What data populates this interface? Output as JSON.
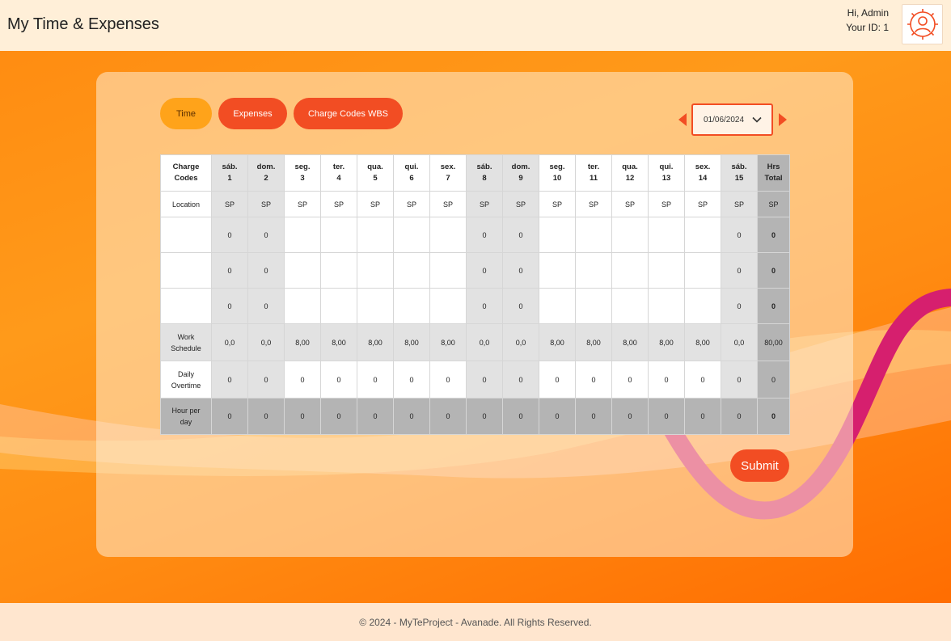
{
  "header": {
    "title": "My Time & Expenses",
    "greeting": "Hi, Admin",
    "user_id": "Your ID: 1"
  },
  "tabs": {
    "time": "Time",
    "expenses": "Expenses",
    "wbs": "Charge Codes WBS"
  },
  "date_picker": {
    "value": "01/06/2024"
  },
  "table": {
    "charge_codes_header": [
      "Charge",
      "Codes"
    ],
    "total_header": [
      "Hrs",
      "Total"
    ],
    "days": [
      {
        "dow": "sáb.",
        "day": "1",
        "weekend": true
      },
      {
        "dow": "dom.",
        "day": "2",
        "weekend": true
      },
      {
        "dow": "seg.",
        "day": "3",
        "weekend": false
      },
      {
        "dow": "ter.",
        "day": "4",
        "weekend": false
      },
      {
        "dow": "qua.",
        "day": "5",
        "weekend": false
      },
      {
        "dow": "qui.",
        "day": "6",
        "weekend": false
      },
      {
        "dow": "sex.",
        "day": "7",
        "weekend": false
      },
      {
        "dow": "sáb.",
        "day": "8",
        "weekend": true
      },
      {
        "dow": "dom.",
        "day": "9",
        "weekend": true
      },
      {
        "dow": "seg.",
        "day": "10",
        "weekend": false
      },
      {
        "dow": "ter.",
        "day": "11",
        "weekend": false
      },
      {
        "dow": "qua.",
        "day": "12",
        "weekend": false
      },
      {
        "dow": "qui.",
        "day": "13",
        "weekend": false
      },
      {
        "dow": "sex.",
        "day": "14",
        "weekend": false
      },
      {
        "dow": "sáb.",
        "day": "15",
        "weekend": true
      }
    ],
    "location_label": "Location",
    "location_values": [
      "SP",
      "SP",
      "SP",
      "SP",
      "SP",
      "SP",
      "SP",
      "SP",
      "SP",
      "SP",
      "SP",
      "SP",
      "SP",
      "SP",
      "SP"
    ],
    "location_total": "SP",
    "entry_rows": [
      {
        "values": [
          "0",
          "0",
          "",
          "",
          "",
          "",
          "",
          "0",
          "0",
          "",
          "",
          "",
          "",
          "",
          "0"
        ],
        "total": "0"
      },
      {
        "values": [
          "0",
          "0",
          "",
          "",
          "",
          "",
          "",
          "0",
          "0",
          "",
          "",
          "",
          "",
          "",
          "0"
        ],
        "total": "0"
      },
      {
        "values": [
          "0",
          "0",
          "",
          "",
          "",
          "",
          "",
          "0",
          "0",
          "",
          "",
          "",
          "",
          "",
          "0"
        ],
        "total": "0"
      }
    ],
    "work_schedule_label": [
      "Work",
      "Schedule"
    ],
    "work_schedule_values": [
      "0,0",
      "0,0",
      "8,00",
      "8,00",
      "8,00",
      "8,00",
      "8,00",
      "0,0",
      "0,0",
      "8,00",
      "8,00",
      "8,00",
      "8,00",
      "8,00",
      "0,0"
    ],
    "work_schedule_total": "80,00",
    "overtime_label": [
      "Daily",
      "Overtime"
    ],
    "overtime_values": [
      "0",
      "0",
      "0",
      "0",
      "0",
      "0",
      "0",
      "0",
      "0",
      "0",
      "0",
      "0",
      "0",
      "0",
      "0"
    ],
    "overtime_total": "0",
    "hour_per_day_label": [
      "Hour per",
      "day"
    ],
    "hour_per_day_values": [
      "0",
      "0",
      "0",
      "0",
      "0",
      "0",
      "0",
      "0",
      "0",
      "0",
      "0",
      "0",
      "0",
      "0",
      "0"
    ],
    "hour_per_day_total": "0"
  },
  "submit_label": "Submit",
  "footer": "© 2024 - MyTeProject - Avanade. All Rights Reserved.",
  "colors": {
    "accent": "#f24d23",
    "tab_active": "#ffa31a",
    "header_bg": "#ffefd8",
    "wave_magenta": "#d61f6e"
  },
  "icons": {
    "avatar": "user-gear-icon",
    "date_chevron": "chevron-down-icon",
    "prev": "arrow-left-icon",
    "next": "arrow-right-icon"
  }
}
